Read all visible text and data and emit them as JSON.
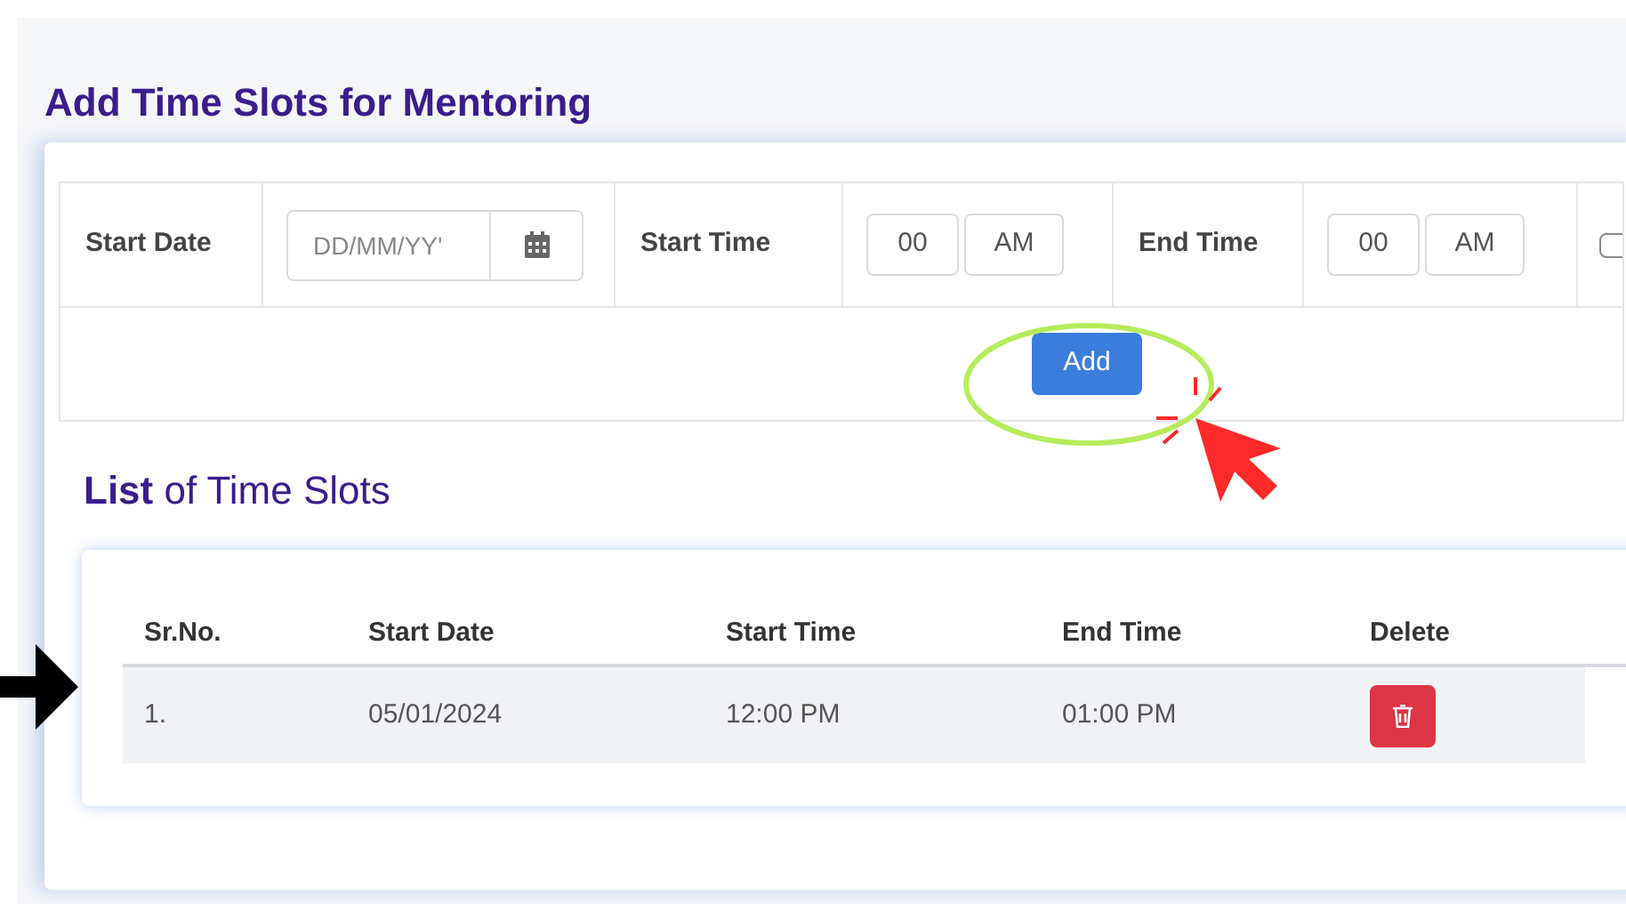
{
  "title": "Add Time Slots for Mentoring",
  "form": {
    "fields": [
      {
        "kind": "date",
        "label": "Start Date",
        "placeholder": "DD/MM/YY'"
      },
      {
        "kind": "time",
        "label": "Start Time",
        "hour": "00",
        "period": "AM"
      },
      {
        "kind": "time",
        "label": "End Time",
        "hour": "00",
        "period": "AM"
      }
    ],
    "add_button": "Add"
  },
  "list_title": "**List** of Time Slots",
  "table": {
    "columns": [
      "Sr.No.",
      "Start Date",
      "Start Time",
      "End Time",
      "Delete"
    ],
    "rows": [
      {
        "cells": [
          "1.",
          "05/01/2024",
          "12:00 PM",
          "01:00 PM"
        ]
      }
    ]
  }
}
